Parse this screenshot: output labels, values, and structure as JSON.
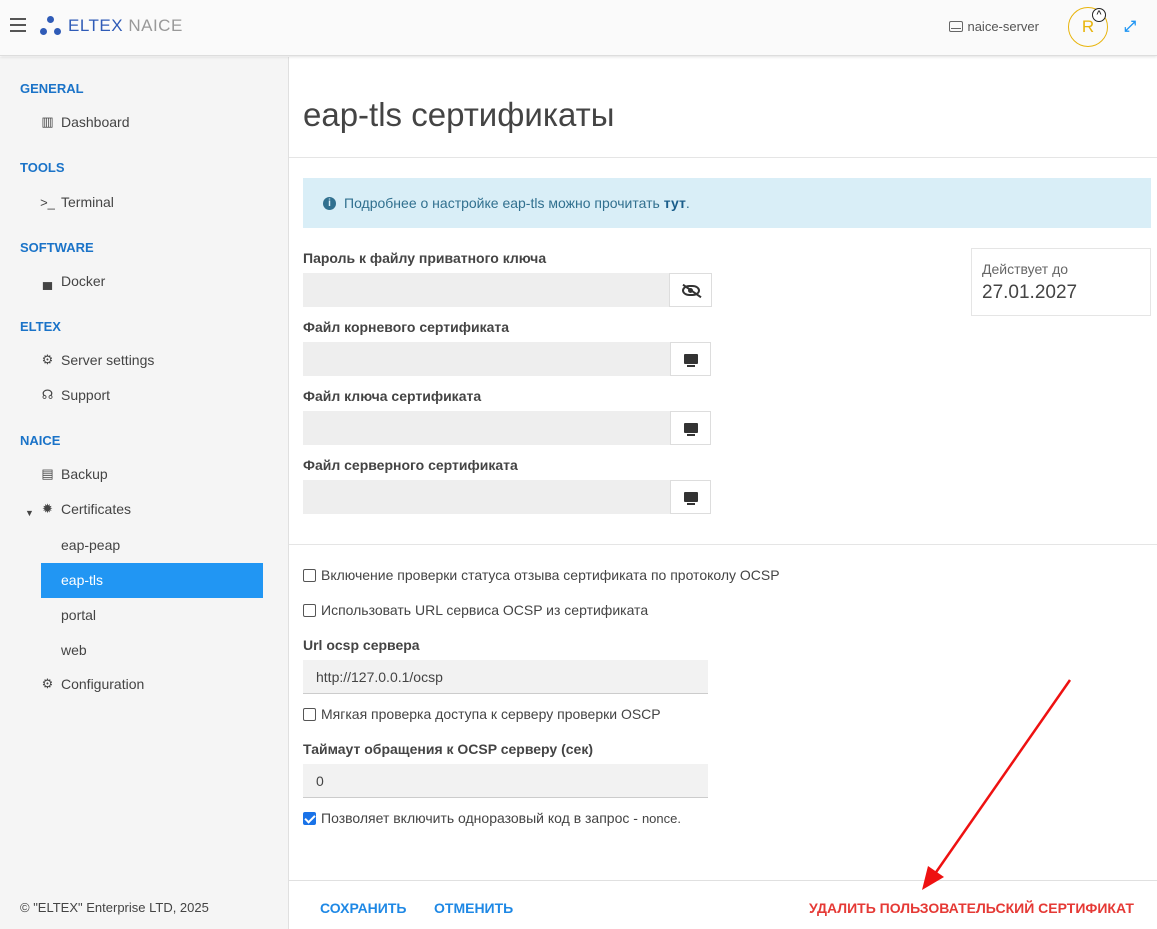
{
  "topbar": {
    "brand": "ELTEX",
    "product": "NAICE",
    "server_name": "naice-server",
    "avatar_letter": "R"
  },
  "sidebar": {
    "sections": [
      {
        "title": "GENERAL"
      },
      {
        "title": "TOOLS"
      },
      {
        "title": "SOFTWARE"
      },
      {
        "title": "ELTEX"
      },
      {
        "title": "NAICE"
      }
    ],
    "items": {
      "dashboard": "Dashboard",
      "terminal": "Terminal",
      "docker": "Docker",
      "server_settings": "Server settings",
      "support": "Support",
      "backup": "Backup",
      "certificates": "Certificates",
      "configuration": "Configuration"
    },
    "certificates_sub": [
      "eap-peap",
      "eap-tls",
      "portal",
      "web"
    ],
    "active_item": "eap-tls",
    "footer": "© \"ELTEX\" Enterprise LTD, 2025"
  },
  "main": {
    "title": "eap-tls сертификаты",
    "info": {
      "text": "Подробнее о настройке eap-tls можно прочитать",
      "link": "тут",
      "suffix": "."
    },
    "fields": {
      "private_key_password": "Пароль к файлу приватного ключа",
      "root_cert_file": "Файл корневого сертификата",
      "cert_key_file": "Файл ключа сертификата",
      "server_cert_file": "Файл серверного сертификата"
    },
    "validity": {
      "label": "Действует до",
      "date": "27.01.2027"
    },
    "ocsp": {
      "enable_check": "Включение проверки статуса отзыва сертификата по протоколу OCSP",
      "use_url_from_cert": "Использовать URL сервиса OCSP из сертификата",
      "url_label": "Url ocsp сервера",
      "url_value": "http://127.0.0.1/ocsp",
      "soft_check": "Мягкая проверка доступа к серверу проверки OSCP",
      "timeout_label": "Таймаут обращения к OCSP серверу (сек)",
      "timeout_value": "0",
      "nonce_label": "Позволяет включить одноразовый код в запрос -",
      "nonce_suffix": "nonce."
    },
    "checkboxes": {
      "enable_check": false,
      "use_url_from_cert": false,
      "soft_check": false,
      "nonce": true
    },
    "buttons": {
      "save": "СОХРАНИТЬ",
      "cancel": "ОТМЕНИТЬ",
      "delete": "УДАЛИТЬ ПОЛЬЗОВАТЕЛЬСКИЙ СЕРТИФИКАТ"
    },
    "colors": {
      "accent": "#2196f3",
      "danger": "#e53935",
      "annotation_arrow": "#ee1111"
    }
  }
}
